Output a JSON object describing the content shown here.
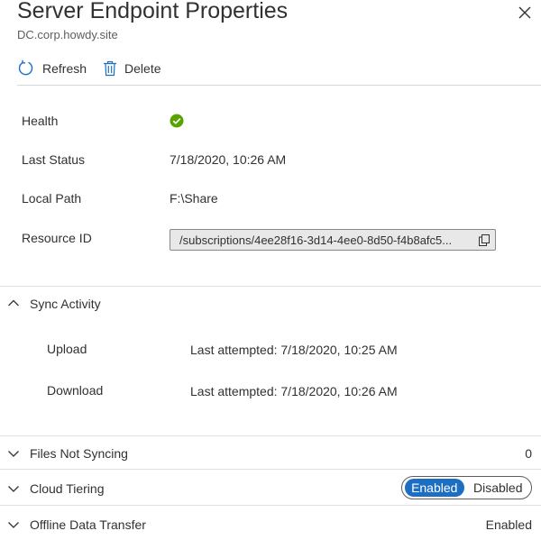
{
  "panel": {
    "title": "Server Endpoint Properties",
    "subtitle": "DC.corp.howdy.site"
  },
  "toolbar": {
    "refresh_label": "Refresh",
    "delete_label": "Delete"
  },
  "properties": {
    "health_label": "Health",
    "health_status_icon": "check-circle-icon",
    "health_color": "#57a300",
    "last_status_label": "Last Status",
    "last_status_value": "7/18/2020, 10:26 AM",
    "local_path_label": "Local Path",
    "local_path_value": "F:\\Share",
    "resource_id_label": "Resource ID",
    "resource_id_value": "/subscriptions/4ee28f16-3d14-4ee0-8d50-f4b8afc5..."
  },
  "sync_activity": {
    "title": "Sync Activity",
    "upload_label": "Upload",
    "upload_value": "Last attempted: 7/18/2020, 10:25 AM",
    "download_label": "Download",
    "download_value": "Last attempted: 7/18/2020, 10:26 AM"
  },
  "files_not_syncing": {
    "title": "Files Not Syncing",
    "count": "0"
  },
  "cloud_tiering": {
    "title": "Cloud Tiering",
    "enabled_label": "Enabled",
    "disabled_label": "Disabled",
    "selected": "Enabled",
    "accent_color": "#1b6ec2"
  },
  "offline_data_transfer": {
    "title": "Offline Data Transfer",
    "status": "Enabled"
  }
}
